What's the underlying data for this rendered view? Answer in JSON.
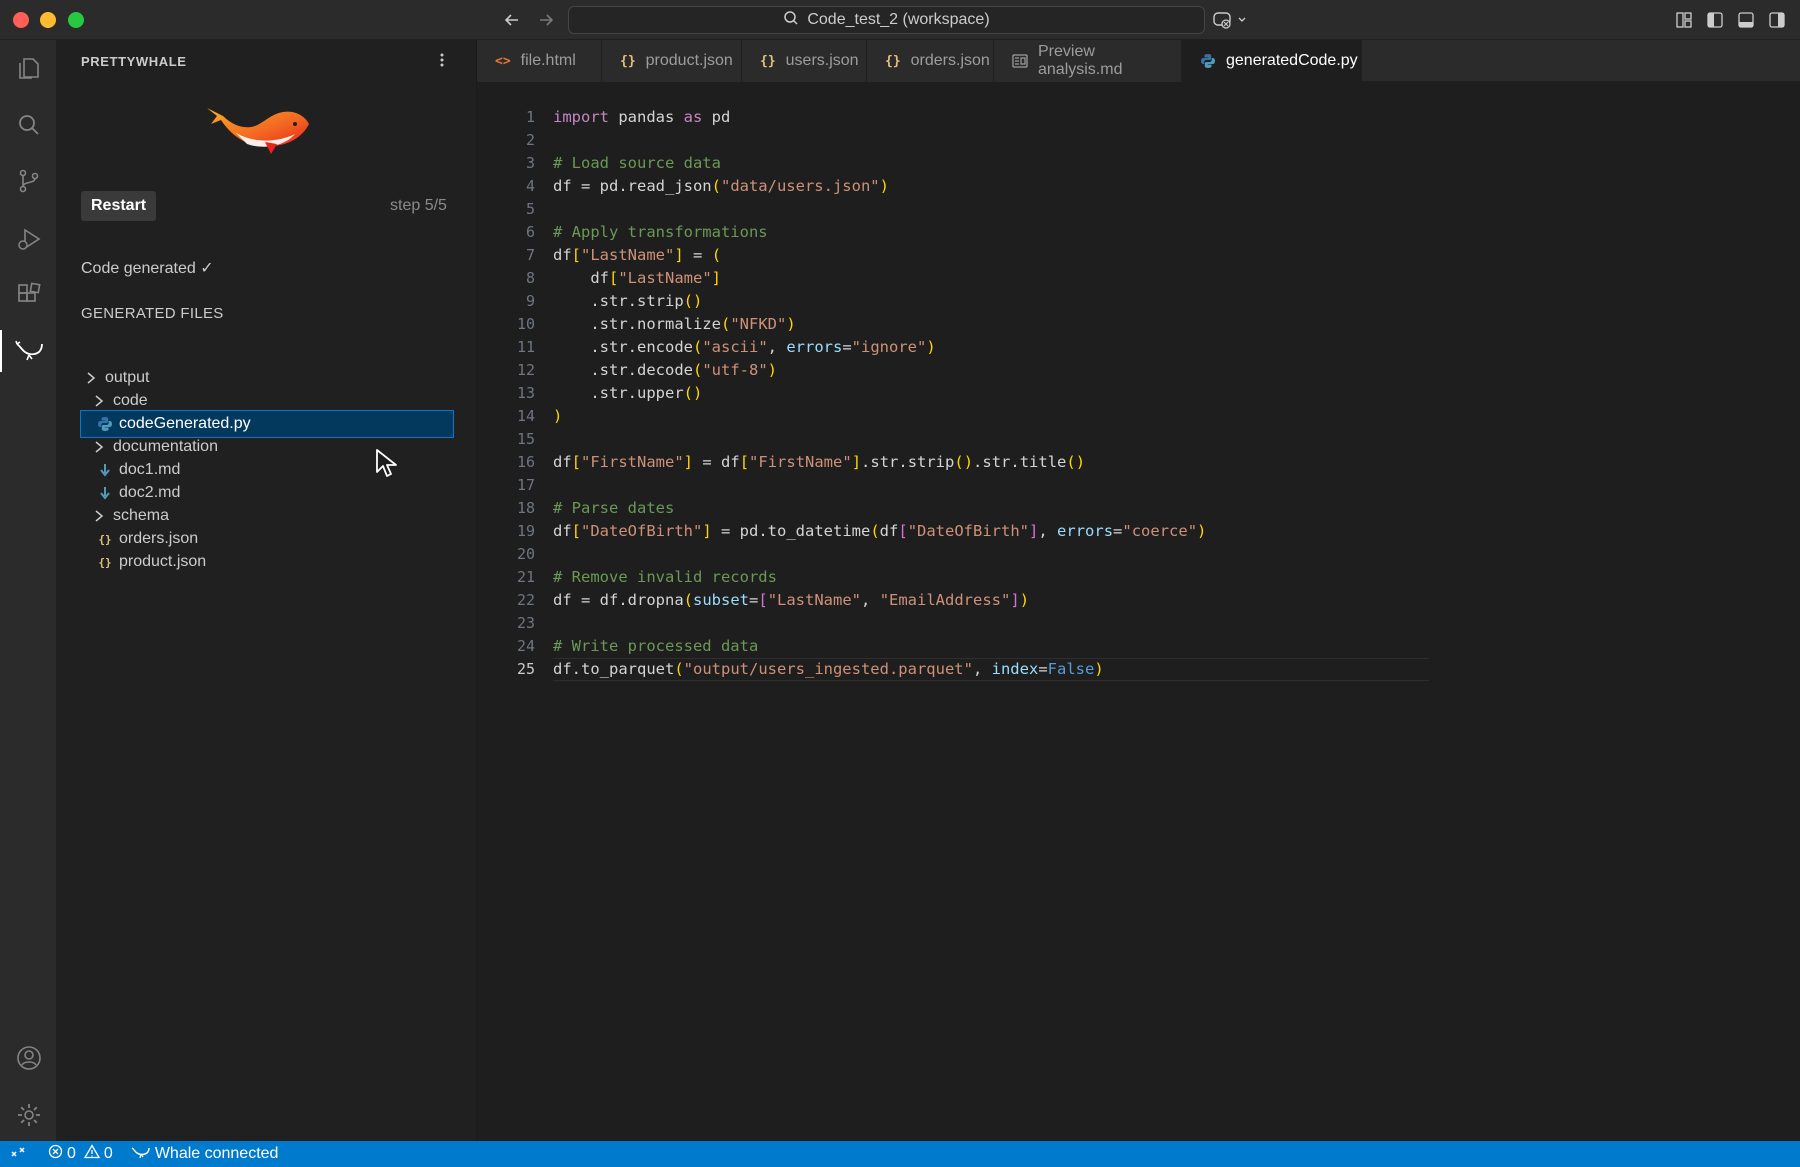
{
  "window": {
    "search_text": "Code_test_2 (workspace)"
  },
  "sidebar": {
    "title": "PRETTYWHALE",
    "restart_label": "Restart",
    "step_text": "step 5/5",
    "status_text": "Code generated ✓",
    "section_title": "GENERATED FILES",
    "tree": [
      {
        "label": "output",
        "kind": "folder",
        "indent": 0
      },
      {
        "label": "code",
        "kind": "folder",
        "indent": 1
      },
      {
        "label": "codeGenerated.py",
        "kind": "python",
        "indent": 1,
        "selected": true
      },
      {
        "label": "documentation",
        "kind": "folder",
        "indent": 1
      },
      {
        "label": "doc1.md",
        "kind": "markdown",
        "indent": 1
      },
      {
        "label": "doc2.md",
        "kind": "markdown",
        "indent": 1
      },
      {
        "label": "schema",
        "kind": "folder",
        "indent": 1
      },
      {
        "label": "orders.json",
        "kind": "json",
        "indent": 1
      },
      {
        "label": "product.json",
        "kind": "json",
        "indent": 1
      }
    ]
  },
  "tabs": [
    {
      "label": "file.html",
      "icon": "html-icon"
    },
    {
      "label": "product.json",
      "icon": "json-icon"
    },
    {
      "label": "users.json",
      "icon": "json-icon"
    },
    {
      "label": "orders.json",
      "icon": "json-icon"
    },
    {
      "label": "Preview analysis.md",
      "icon": "preview-icon"
    },
    {
      "label": "generatedCode.py",
      "icon": "python-icon",
      "active": true
    }
  ],
  "editor": {
    "current_line": 25,
    "line_numbers": [
      "1",
      "2",
      "3",
      "4",
      "5",
      "6",
      "7",
      "8",
      "9",
      "10",
      "11",
      "12",
      "13",
      "14",
      "15",
      "16",
      "17",
      "18",
      "19",
      "20",
      "21",
      "22",
      "23",
      "24",
      "25"
    ],
    "lines": [
      "import pandas as pd",
      "",
      "# Load source data",
      "df = pd.read_json(\"data/users.json\")",
      "",
      "# Apply transformations",
      "df[\"LastName\"] = (",
      "    df[\"LastName\"]",
      "    .str.strip()",
      "    .str.normalize(\"NFKD\")",
      "    .str.encode(\"ascii\", errors=\"ignore\")",
      "    .str.decode(\"utf-8\")",
      "    .str.upper()",
      ")",
      "",
      "df[\"FirstName\"] = df[\"FirstName\"].str.strip().str.title()",
      "",
      "# Parse dates",
      "df[\"DateOfBirth\"] = pd.to_datetime(df[\"DateOfBirth\"], errors=\"coerce\")",
      "",
      "# Remove invalid records",
      "df = df.dropna(subset=[\"LastName\", \"EmailAddress\"])",
      "",
      "# Write processed data",
      "df.to_parquet(\"output/users_ingested.parquet\", index=False)"
    ]
  },
  "statusbar": {
    "errors": "0",
    "warnings": "0",
    "whale_status": "Whale connected"
  },
  "colors": {
    "accent": "#007acc",
    "selection": "#04395e",
    "whale_orange": "#f26522"
  }
}
